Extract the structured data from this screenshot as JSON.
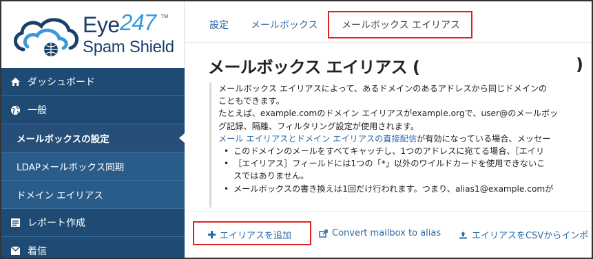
{
  "logo": {
    "line1": "Eye",
    "digits": "247",
    "tm": "TM",
    "line2": "Spam Shield"
  },
  "sidebar": {
    "items": [
      {
        "label": "ダッシュボード",
        "icon": "home-icon"
      },
      {
        "label": "一般",
        "icon": "globe-icon"
      },
      {
        "label": "メールボックスの設定",
        "icon": ""
      },
      {
        "label": "LDAPメールボックス同期",
        "icon": ""
      },
      {
        "label": "ドメイン エイリアス",
        "icon": ""
      },
      {
        "label": "レポート作成",
        "icon": "report-icon"
      },
      {
        "label": "着信",
        "icon": "inbox-icon"
      }
    ]
  },
  "tabs": [
    {
      "label": "設定"
    },
    {
      "label": "メールボックス"
    },
    {
      "label": "メールボックス エイリアス"
    }
  ],
  "page": {
    "title": "メールボックス エイリアス (",
    "title_close": ")"
  },
  "description": {
    "p1_line1": "メールボックス エイリアスによって、あるドメインのあるアドレスから同じドメインの",
    "p1_line2": "こともできます。",
    "p2_line1": "たとえば、example.comのドメイン エイリアスがexample.orgで、user@のメールボッ",
    "p2_line2": "グ記録、隔離、フィルタリング設定が使用されます。",
    "p3_link": "メール エイリアスとドメイン エイリアスの直接配信",
    "p3_rest": "が有効になっている場合、メッセー",
    "bullet1": "このドメインのメールをすべてキャッチし、1つのアドレスに宛てる場合、［エイリ",
    "bullet2_line1": "［エイリアス］フィールドには1つの「*」以外のワイルドカードを使用できないこ",
    "bullet2_line2": "スではありません。",
    "bullet3": "メールボックスの書き換えは1回だけ行われます。つまり、alias1@example.comが"
  },
  "actions": {
    "add_label": "エイリアスを追加",
    "convert_label": "Convert mailbox to alias",
    "csv_label": "エイリアスをCSVからインポ"
  },
  "colors": {
    "sidebar_bg": "#2a5c8a",
    "link": "#2b6aa8",
    "highlight_box": "#e02020"
  }
}
